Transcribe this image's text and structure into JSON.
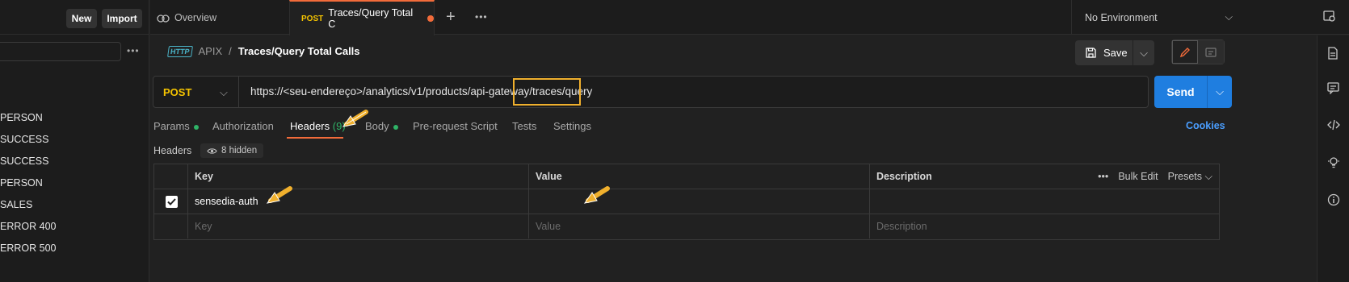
{
  "sidebar": {
    "new_label": "New",
    "import_label": "Import",
    "items": [
      "PERSON",
      "SUCCESS",
      "SUCCESS",
      "PERSON",
      "SALES",
      "ERROR 400",
      "ERROR 500"
    ]
  },
  "tabs": {
    "overview_label": "Overview",
    "active_method": "POST",
    "active_label": "Traces/Query Total C",
    "environment": "No Environment"
  },
  "request": {
    "collection": "APIX",
    "separator": "/",
    "name": "Traces/Query Total Calls",
    "save_label": "Save",
    "method": "POST",
    "url": "https://<seu-endereço>/analytics/v1/products/api-gateway/traces/query",
    "send_label": "Send"
  },
  "request_tabs": {
    "params": "Params",
    "authorization": "Authorization",
    "headers": "Headers",
    "headers_count": "(9)",
    "body": "Body",
    "prerequest": "Pre-request Script",
    "tests": "Tests",
    "settings": "Settings",
    "cookies": "Cookies"
  },
  "headers_section": {
    "label": "Headers",
    "hidden": "8 hidden",
    "columns": {
      "key": "Key",
      "value": "Value",
      "description": "Description"
    },
    "bulk_edit": "Bulk Edit",
    "presets": "Presets",
    "rows": [
      {
        "key": "sensedia-auth",
        "value": "",
        "description": "",
        "checked": true
      }
    ],
    "placeholders": {
      "key": "Key",
      "value": "Value",
      "description": "Description"
    }
  },
  "colors": {
    "accent": "#f26b3a",
    "send": "#1f7ee0",
    "method": "#f5c400",
    "highlight": "#f0b02d"
  }
}
